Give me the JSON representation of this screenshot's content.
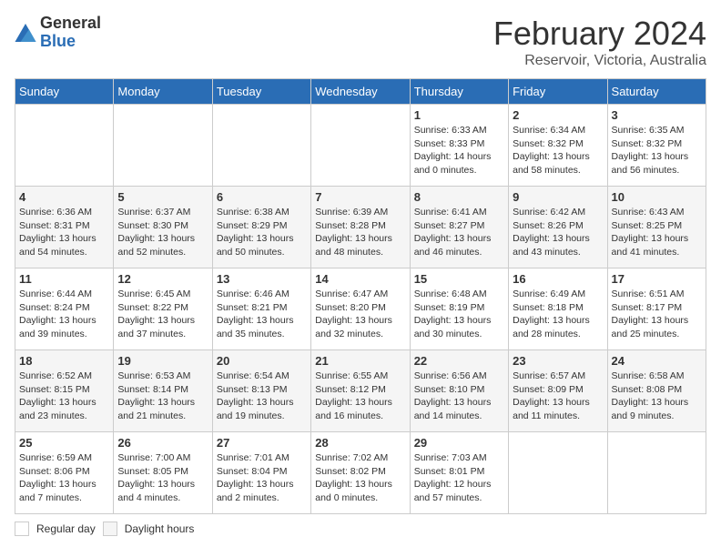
{
  "header": {
    "logo_general": "General",
    "logo_blue": "Blue",
    "month_title": "February 2024",
    "location": "Reservoir, Victoria, Australia"
  },
  "weekdays": [
    "Sunday",
    "Monday",
    "Tuesday",
    "Wednesday",
    "Thursday",
    "Friday",
    "Saturday"
  ],
  "weeks": [
    [
      {
        "day": "",
        "info": ""
      },
      {
        "day": "",
        "info": ""
      },
      {
        "day": "",
        "info": ""
      },
      {
        "day": "",
        "info": ""
      },
      {
        "day": "1",
        "info": "Sunrise: 6:33 AM\nSunset: 8:33 PM\nDaylight: 14 hours and 0 minutes."
      },
      {
        "day": "2",
        "info": "Sunrise: 6:34 AM\nSunset: 8:32 PM\nDaylight: 13 hours and 58 minutes."
      },
      {
        "day": "3",
        "info": "Sunrise: 6:35 AM\nSunset: 8:32 PM\nDaylight: 13 hours and 56 minutes."
      }
    ],
    [
      {
        "day": "4",
        "info": "Sunrise: 6:36 AM\nSunset: 8:31 PM\nDaylight: 13 hours and 54 minutes."
      },
      {
        "day": "5",
        "info": "Sunrise: 6:37 AM\nSunset: 8:30 PM\nDaylight: 13 hours and 52 minutes."
      },
      {
        "day": "6",
        "info": "Sunrise: 6:38 AM\nSunset: 8:29 PM\nDaylight: 13 hours and 50 minutes."
      },
      {
        "day": "7",
        "info": "Sunrise: 6:39 AM\nSunset: 8:28 PM\nDaylight: 13 hours and 48 minutes."
      },
      {
        "day": "8",
        "info": "Sunrise: 6:41 AM\nSunset: 8:27 PM\nDaylight: 13 hours and 46 minutes."
      },
      {
        "day": "9",
        "info": "Sunrise: 6:42 AM\nSunset: 8:26 PM\nDaylight: 13 hours and 43 minutes."
      },
      {
        "day": "10",
        "info": "Sunrise: 6:43 AM\nSunset: 8:25 PM\nDaylight: 13 hours and 41 minutes."
      }
    ],
    [
      {
        "day": "11",
        "info": "Sunrise: 6:44 AM\nSunset: 8:24 PM\nDaylight: 13 hours and 39 minutes."
      },
      {
        "day": "12",
        "info": "Sunrise: 6:45 AM\nSunset: 8:22 PM\nDaylight: 13 hours and 37 minutes."
      },
      {
        "day": "13",
        "info": "Sunrise: 6:46 AM\nSunset: 8:21 PM\nDaylight: 13 hours and 35 minutes."
      },
      {
        "day": "14",
        "info": "Sunrise: 6:47 AM\nSunset: 8:20 PM\nDaylight: 13 hours and 32 minutes."
      },
      {
        "day": "15",
        "info": "Sunrise: 6:48 AM\nSunset: 8:19 PM\nDaylight: 13 hours and 30 minutes."
      },
      {
        "day": "16",
        "info": "Sunrise: 6:49 AM\nSunset: 8:18 PM\nDaylight: 13 hours and 28 minutes."
      },
      {
        "day": "17",
        "info": "Sunrise: 6:51 AM\nSunset: 8:17 PM\nDaylight: 13 hours and 25 minutes."
      }
    ],
    [
      {
        "day": "18",
        "info": "Sunrise: 6:52 AM\nSunset: 8:15 PM\nDaylight: 13 hours and 23 minutes."
      },
      {
        "day": "19",
        "info": "Sunrise: 6:53 AM\nSunset: 8:14 PM\nDaylight: 13 hours and 21 minutes."
      },
      {
        "day": "20",
        "info": "Sunrise: 6:54 AM\nSunset: 8:13 PM\nDaylight: 13 hours and 19 minutes."
      },
      {
        "day": "21",
        "info": "Sunrise: 6:55 AM\nSunset: 8:12 PM\nDaylight: 13 hours and 16 minutes."
      },
      {
        "day": "22",
        "info": "Sunrise: 6:56 AM\nSunset: 8:10 PM\nDaylight: 13 hours and 14 minutes."
      },
      {
        "day": "23",
        "info": "Sunrise: 6:57 AM\nSunset: 8:09 PM\nDaylight: 13 hours and 11 minutes."
      },
      {
        "day": "24",
        "info": "Sunrise: 6:58 AM\nSunset: 8:08 PM\nDaylight: 13 hours and 9 minutes."
      }
    ],
    [
      {
        "day": "25",
        "info": "Sunrise: 6:59 AM\nSunset: 8:06 PM\nDaylight: 13 hours and 7 minutes."
      },
      {
        "day": "26",
        "info": "Sunrise: 7:00 AM\nSunset: 8:05 PM\nDaylight: 13 hours and 4 minutes."
      },
      {
        "day": "27",
        "info": "Sunrise: 7:01 AM\nSunset: 8:04 PM\nDaylight: 13 hours and 2 minutes."
      },
      {
        "day": "28",
        "info": "Sunrise: 7:02 AM\nSunset: 8:02 PM\nDaylight: 13 hours and 0 minutes."
      },
      {
        "day": "29",
        "info": "Sunrise: 7:03 AM\nSunset: 8:01 PM\nDaylight: 12 hours and 57 minutes."
      },
      {
        "day": "",
        "info": ""
      },
      {
        "day": "",
        "info": ""
      }
    ]
  ],
  "legend": {
    "white_label": "Regular day",
    "gray_label": "Daylight hours"
  }
}
